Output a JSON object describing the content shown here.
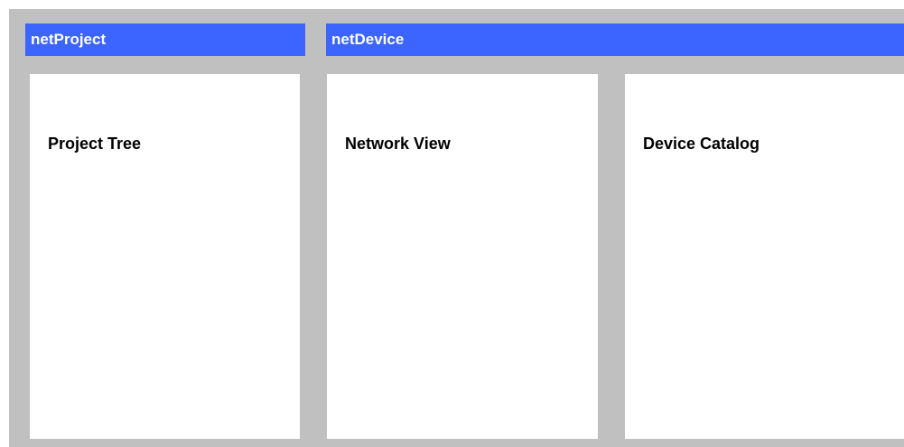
{
  "colors": {
    "header_bg": "#3c64ff",
    "header_text": "#ffffff",
    "frame_bg": "#c0c0c0",
    "pane_bg": "#ffffff",
    "label_text": "#000000"
  },
  "headers": {
    "left": "netProject",
    "right": "netDevice"
  },
  "panes": {
    "project_tree": "Project Tree",
    "network_view": "Network View",
    "device_catalog": "Device Catalog"
  }
}
